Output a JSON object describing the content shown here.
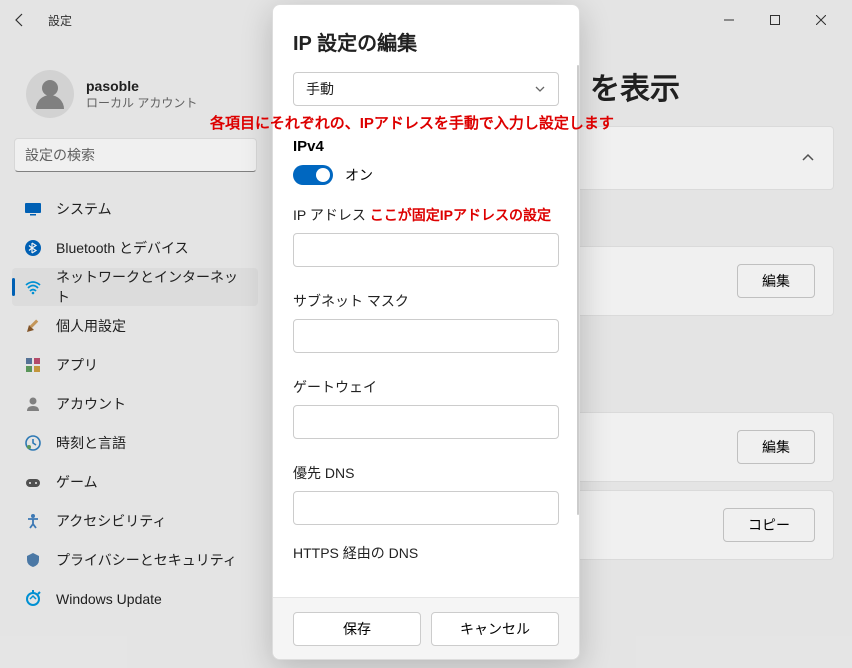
{
  "header": {
    "title": "設定"
  },
  "user": {
    "name": "pasoble",
    "sub": "ローカル アカウント"
  },
  "search": {
    "placeholder": "設定の検索"
  },
  "nav": [
    {
      "label": "システム",
      "icon": "system"
    },
    {
      "label": "Bluetooth とデバイス",
      "icon": "bluetooth"
    },
    {
      "label": "ネットワークとインターネット",
      "icon": "network",
      "active": true
    },
    {
      "label": "個人用設定",
      "icon": "personalize"
    },
    {
      "label": "アプリ",
      "icon": "apps"
    },
    {
      "label": "アカウント",
      "icon": "account"
    },
    {
      "label": "時刻と言語",
      "icon": "time"
    },
    {
      "label": "ゲーム",
      "icon": "game"
    },
    {
      "label": "アクセシビリティ",
      "icon": "accessibility"
    },
    {
      "label": "プライバシーとセキュリティ",
      "icon": "privacy"
    },
    {
      "label": "Windows Update",
      "icon": "update"
    }
  ],
  "main": {
    "title_suffix": "を表示",
    "buttons": {
      "edit": "編集",
      "copy": "コピー"
    }
  },
  "annotation": {
    "top_red": "各項目にそれぞれの、IPアドレスを手動で入力し設定します",
    "ip_note": "ここが固定IPアドレスの設定"
  },
  "modal": {
    "title": "IP 設定の編集",
    "select_value": "手動",
    "ipv4_heading": "IPv4",
    "toggle_label": "オン",
    "fields": {
      "ip": "IP アドレス",
      "subnet": "サブネット マスク",
      "gateway": "ゲートウェイ",
      "dns": "優先 DNS",
      "https_dns": "HTTPS 経由の DNS"
    },
    "save": "保存",
    "cancel": "キャンセル"
  }
}
